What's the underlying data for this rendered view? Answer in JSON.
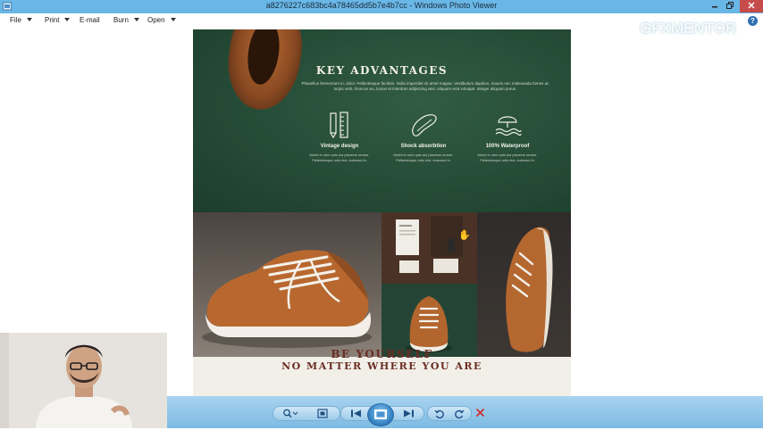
{
  "window": {
    "title": "a8276227c683bc4a78465dd5b7e4b7cc - Windows Photo Viewer",
    "controls": [
      "minimize",
      "restore",
      "close"
    ]
  },
  "menu": {
    "items": [
      {
        "label": "File",
        "has_dropdown": true
      },
      {
        "label": "Print",
        "has_dropdown": true
      },
      {
        "label": "E-mail",
        "has_dropdown": false
      },
      {
        "label": "Burn",
        "has_dropdown": true
      },
      {
        "label": "Open",
        "has_dropdown": true
      }
    ],
    "help_icon": "help-icon"
  },
  "watermark": "GFXMENTOR",
  "photo": {
    "section1_title": "KEY ADVANTAGES",
    "section1_subtitle": "Phasellus fermentum in, dolor. Pellentesque facilisis. Nulla imperdiet sit amet magna. Vestibulum dapibus, mauris nec malesuada fames ac turpis velit, rhoncus eu, luctus et interdum adipiscing wisi. Aliquam erat volutpat. Integer aliquam purus.",
    "features": [
      {
        "icon": "pencil-ruler-icon",
        "label": "Vintage design",
        "desc": "Morbi in sem quis dui placerat ornare. Pellentesque odio nisi, euismod in."
      },
      {
        "icon": "shoe-sole-icon",
        "label": "Shock absorbtion",
        "desc": "Morbi in sem quis dui placerat ornare. Pellentesque odio nisi, euismod in."
      },
      {
        "icon": "umbrella-waves-icon",
        "label": "100% Waterproof",
        "desc": "Morbi in sem quis dui placerat ornare. Pellentesque odio nisi, euismod in."
      }
    ],
    "section2_title_line1": "BE YOURSELF",
    "section2_title_line2": "NO MATTER WHERE YOU ARE"
  },
  "toolbar": {
    "buttons": [
      "zoom-icon",
      "actual-size-icon",
      "previous-icon",
      "slideshow-icon",
      "next-icon",
      "rotate-counterclockwise-icon",
      "rotate-clockwise-icon",
      "delete-icon"
    ]
  },
  "colors": {
    "titlebar": "#69b7e6",
    "toolbar": "#8cc6ea",
    "green_panel": "#264c37",
    "heading_brown": "#6a2d23",
    "close_red": "#c64b4b"
  }
}
